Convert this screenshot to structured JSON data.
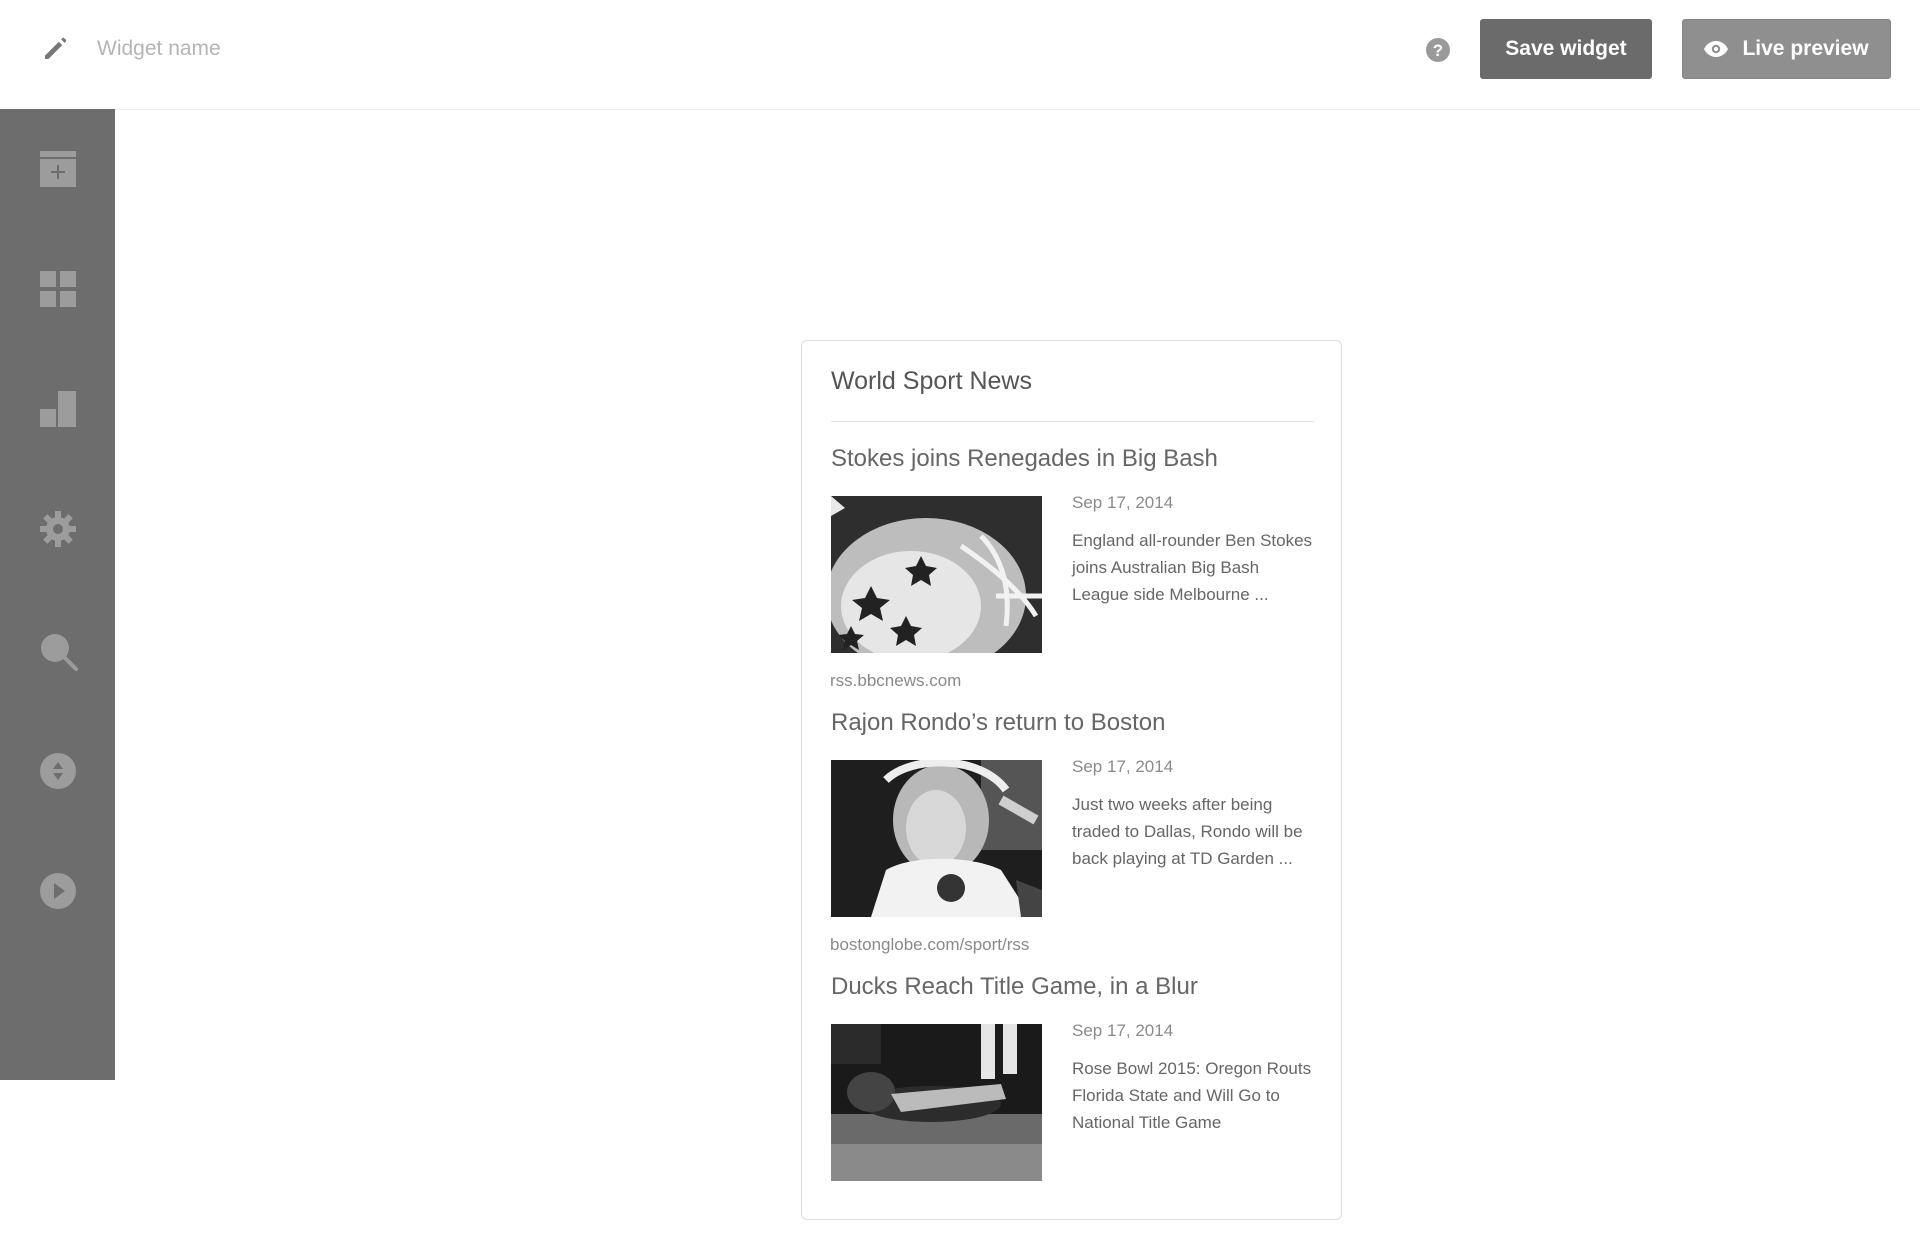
{
  "header": {
    "widget_name_placeholder": "Widget name",
    "widget_name_value": "",
    "save_label": "Save widget",
    "preview_label": "Live preview"
  },
  "sidebar": {
    "items": [
      {
        "icon": "add-widget-icon"
      },
      {
        "icon": "dashboard-grid-icon"
      },
      {
        "icon": "layout-icon"
      },
      {
        "icon": "gear-icon"
      },
      {
        "icon": "search-icon"
      },
      {
        "icon": "sort-icon"
      },
      {
        "icon": "play-icon"
      }
    ]
  },
  "widget": {
    "title": "World Sport News",
    "items": [
      {
        "headline": "Stokes joins Renegades in Big Bash",
        "date": "Sep 17, 2014",
        "description": "England all-rounder Ben Stokes joins Australian Big Bash League side Melbourne ...",
        "source": "rss.bbcnews.com",
        "image": "helmet-closeup-photo"
      },
      {
        "headline": "Rajon Rondo’s return to Boston",
        "date": "Sep 17, 2014",
        "description": "Just two weeks after being traded to Dallas, Rondo will be back playing at TD Garden ...",
        "source": "bostonglobe.com/sport/rss",
        "image": "football-player-smiling-photo"
      },
      {
        "headline": "Ducks Reach Title Game, in a Blur",
        "date": "Sep 17, 2014",
        "description": "Rose Bowl 2015: Oregon Routs Florida State and Will Go to National Title Game",
        "source": "",
        "image": "player-on-field-photo"
      }
    ]
  },
  "colors": {
    "sidebar_bg": "#6d6d6d",
    "sidebar_icon": "#9c9c9c",
    "save_button": "#6b6b6b",
    "preview_button": "#8f8f8f"
  }
}
